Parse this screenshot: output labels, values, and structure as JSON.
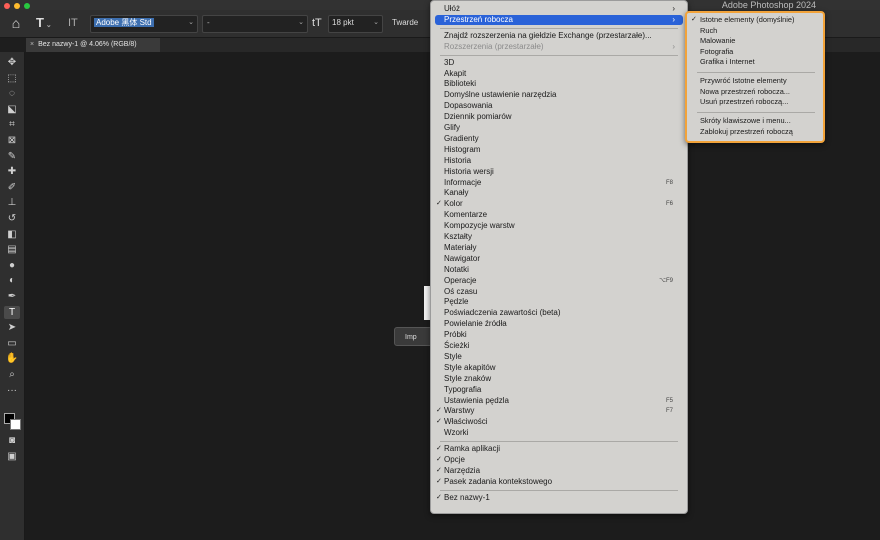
{
  "app": {
    "title": "Adobe Photoshop 2024",
    "traffic_colors": [
      "#ff5f57",
      "#febc2e",
      "#28c840"
    ]
  },
  "options_bar": {
    "home_icon": "home-icon",
    "type_tool_icon": "T",
    "orientation_icon": "IT",
    "font_family": "Adobe 黑体 Std",
    "font_style": "-",
    "size_icon": "tT",
    "font_size": "18 pkt",
    "antialias": "Twarde"
  },
  "document": {
    "tab_title": "Bez nazwy-1 @ 4.06% (RGB/8)",
    "close_glyph": "×"
  },
  "context_bar": {
    "label": "Imp"
  },
  "window_menu": {
    "highlight_color": "#2a62d8",
    "items": [
      {
        "label": "Ułóż",
        "arrow": "›"
      },
      {
        "label": "Przestrzeń robocza",
        "arrow": "›",
        "highlighted": true
      },
      {
        "separator": true
      },
      {
        "label": "Znajdź rozszerzenia na giełdzie Exchange (przestarzałe)..."
      },
      {
        "label": "Rozszerzenia (przestarzałe)",
        "disabled": true,
        "arrow": "›"
      },
      {
        "separator": true
      },
      {
        "label": "3D"
      },
      {
        "label": "Akapit"
      },
      {
        "label": "Biblioteki"
      },
      {
        "label": "Domyślne ustawienie narzędzia"
      },
      {
        "label": "Dopasowania"
      },
      {
        "label": "Dziennik pomiarów"
      },
      {
        "label": "Glify"
      },
      {
        "label": "Gradienty"
      },
      {
        "label": "Histogram"
      },
      {
        "label": "Historia"
      },
      {
        "label": "Historia wersji"
      },
      {
        "label": "Informacje",
        "shortcut": "F8"
      },
      {
        "label": "Kanały"
      },
      {
        "label": "Kolor",
        "checked": true,
        "shortcut": "F6"
      },
      {
        "label": "Komentarze"
      },
      {
        "label": "Kompozycje warstw"
      },
      {
        "label": "Kształty"
      },
      {
        "label": "Materiały"
      },
      {
        "label": "Nawigator"
      },
      {
        "label": "Notatki"
      },
      {
        "label": "Operacje",
        "shortcut": "⌥F9"
      },
      {
        "label": "Oś czasu"
      },
      {
        "label": "Pędzle"
      },
      {
        "label": "Poświadczenia zawartości (beta)"
      },
      {
        "label": "Powielanie źródła"
      },
      {
        "label": "Próbki"
      },
      {
        "label": "Ścieżki"
      },
      {
        "label": "Style"
      },
      {
        "label": "Style akapitów"
      },
      {
        "label": "Style znaków"
      },
      {
        "label": "Typografia"
      },
      {
        "label": "Ustawienia pędzla",
        "shortcut": "F5"
      },
      {
        "label": "Warstwy",
        "checked": true,
        "shortcut": "F7"
      },
      {
        "label": "Właściwości",
        "checked": true
      },
      {
        "label": "Wzorki"
      },
      {
        "separator": true
      },
      {
        "label": "Ramka aplikacji",
        "checked": true
      },
      {
        "label": "Opcje",
        "checked": true
      },
      {
        "label": "Narzędzia",
        "checked": true
      },
      {
        "label": "Pasek zadania kontekstowego",
        "checked": true
      },
      {
        "separator": true
      },
      {
        "label": "Bez nazwy-1",
        "checked": true
      }
    ]
  },
  "workspace_submenu": {
    "border_color": "#f2a33a",
    "check_glyph": "✓",
    "items": [
      {
        "label": "Istotne elementy (domyślnie)",
        "checked": true
      },
      {
        "label": "Ruch"
      },
      {
        "label": "Malowanie"
      },
      {
        "label": "Fotografia"
      },
      {
        "label": "Grafika i Internet"
      },
      {
        "separator": true
      },
      {
        "label": "Przywróć Istotne elementy"
      },
      {
        "label": "Nowa przestrzeń robocza..."
      },
      {
        "label": "Usuń przestrzeń roboczą..."
      },
      {
        "separator": true
      },
      {
        "label": "Skróty klawiszowe i menu..."
      },
      {
        "label": "Zablokuj przestrzeń roboczą"
      }
    ]
  },
  "toolbar": {
    "tools": [
      {
        "name": "move-tool-icon",
        "glyph": "✥"
      },
      {
        "name": "marquee-tool-icon",
        "glyph": "⬚"
      },
      {
        "name": "lasso-tool-icon",
        "glyph": "◌"
      },
      {
        "name": "object-select-tool-icon",
        "glyph": "⬕"
      },
      {
        "name": "crop-tool-icon",
        "glyph": "⌗"
      },
      {
        "name": "frame-tool-icon",
        "glyph": "⊠"
      },
      {
        "name": "eyedropper-tool-icon",
        "glyph": "✎"
      },
      {
        "name": "healing-brush-tool-icon",
        "glyph": "✚"
      },
      {
        "name": "brush-tool-icon",
        "glyph": "✐"
      },
      {
        "name": "clone-stamp-tool-icon",
        "glyph": "⊥"
      },
      {
        "name": "history-brush-tool-icon",
        "glyph": "↺"
      },
      {
        "name": "eraser-tool-icon",
        "glyph": "◧"
      },
      {
        "name": "gradient-tool-icon",
        "glyph": "▤"
      },
      {
        "name": "blur-tool-icon",
        "glyph": "●"
      },
      {
        "name": "dodge-tool-icon",
        "glyph": "◐"
      },
      {
        "name": "pen-tool-icon",
        "glyph": "✒"
      },
      {
        "name": "type-tool-icon",
        "glyph": "T",
        "active": true
      },
      {
        "name": "path-select-tool-icon",
        "glyph": "➤"
      },
      {
        "name": "rectangle-tool-icon",
        "glyph": "▭"
      },
      {
        "name": "hand-tool-icon",
        "glyph": "✋"
      },
      {
        "name": "zoom-tool-icon",
        "glyph": "⌕"
      },
      {
        "name": "more-tools-icon",
        "glyph": "···"
      }
    ],
    "mode_tools": [
      {
        "name": "quick-mask-icon",
        "glyph": "◙"
      },
      {
        "name": "screen-mode-icon",
        "glyph": "▣"
      }
    ]
  }
}
